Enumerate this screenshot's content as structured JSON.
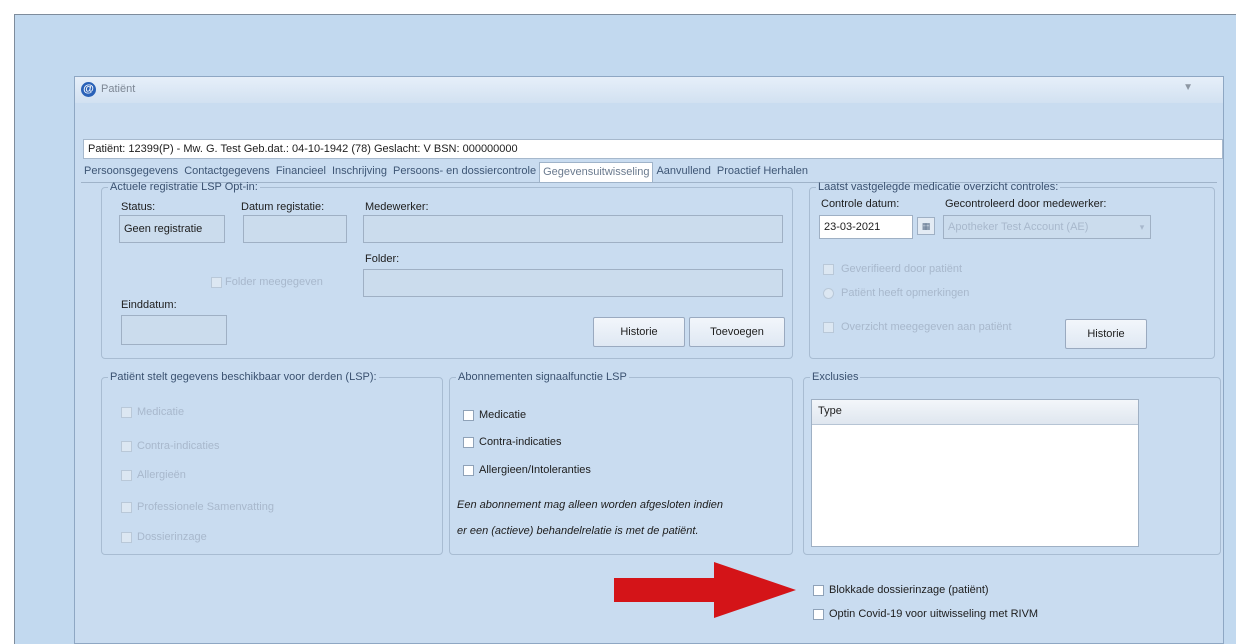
{
  "window": {
    "title": "Patiënt",
    "icon": "app-logo-icon"
  },
  "patient_info": "Patiënt: 12399(P) - Mw. G. Test Geb.dat.: 04-10-1942 (78) Geslacht: V BSN: 000000000",
  "tabs": [
    {
      "label": "Persoonsgegevens",
      "active": false
    },
    {
      "label": "Contactgegevens",
      "active": false
    },
    {
      "label": "Financieel",
      "active": false
    },
    {
      "label": "Inschrijving",
      "active": false
    },
    {
      "label": "Persoons- en dossiercontrole",
      "active": false
    },
    {
      "label": "Gegevensuitwisseling",
      "active": true
    },
    {
      "label": "Aanvullend",
      "active": false
    },
    {
      "label": "Proactief Herhalen",
      "active": false
    }
  ],
  "lsp_optin": {
    "legend": "Actuele registratie LSP Opt-in:",
    "status_label": "Status:",
    "status_value": "Geen registratie",
    "datum_label": "Datum registatie:",
    "medewerker_label": "Medewerker:",
    "folder_label": "Folder:",
    "folder_cb_label": "Folder meegegeven",
    "einddatum_label": "Einddatum:",
    "historie_button": "Historie",
    "toevoegen_button": "Toevoegen"
  },
  "medicatie_controle": {
    "legend": "Laatst vastgelegde medicatie overzicht controles:",
    "controle_datum_label": "Controle datum:",
    "controle_datum_value": "23-03-2021",
    "gecontroleerd_label": "Gecontroleerd door medewerker:",
    "gecontroleerd_value": "Apotheker Test Account (AE)",
    "cb_geverifieerd": "Geverifieerd door patiënt",
    "radio_wijzigingen": "Patiënt heeft opmerkingen",
    "cb_overzicht": "Overzicht meegegeven aan patiënt",
    "historie_button": "Historie"
  },
  "derden": {
    "legend": "Patiënt stelt gegevens beschikbaar voor derden (LSP):",
    "items": [
      "Medicatie",
      "Contra-indicaties",
      "Allergieën",
      "Professionele Samenvatting",
      "Dossierinzage"
    ]
  },
  "abonnementen": {
    "legend": "Abonnementen signaalfunctie LSP",
    "items": [
      "Medicatie",
      "Contra-indicaties",
      "Allergieen/Intoleranties"
    ],
    "note_line1": "Een abonnement mag alleen worden afgesloten indien",
    "note_line2": "er een (actieve) behandelrelatie is met de patiënt."
  },
  "exclusies": {
    "legend": "Exclusies",
    "column_header": "Type"
  },
  "bottom_options": [
    "Blokkade dossierinzage (patiënt)",
    "Optin Covid-19 voor uitwisseling met RIVM"
  ],
  "colors": {
    "arrow": "#d41418",
    "window_bg": "#c9dcf0"
  }
}
